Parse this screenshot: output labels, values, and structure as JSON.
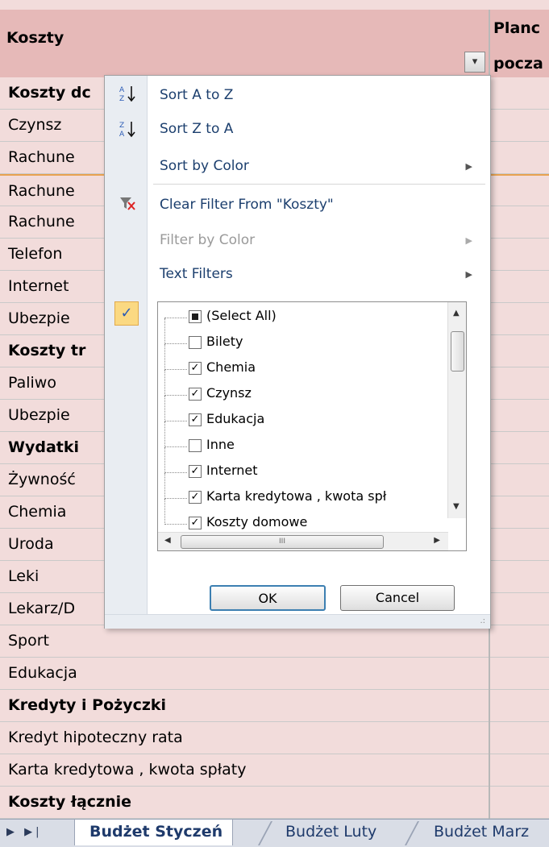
{
  "header": {
    "col_a": "Koszty",
    "col_b_line1": "Planc",
    "col_b_line2": "pocza"
  },
  "rows": [
    {
      "label": "Koszty dc",
      "bold": true
    },
    {
      "label": "Czynsz",
      "bold": false
    },
    {
      "label": "Rachune",
      "bold": false
    },
    {
      "label": "Rachune",
      "bold": false
    },
    {
      "label": "Rachune",
      "bold": false
    },
    {
      "label": "Telefon",
      "bold": false
    },
    {
      "label": "Internet",
      "bold": false
    },
    {
      "label": "Ubezpie",
      "bold": false
    },
    {
      "label": "Koszty tr",
      "bold": true
    },
    {
      "label": "Paliwo",
      "bold": false
    },
    {
      "label": "Ubezpie",
      "bold": false
    },
    {
      "label": "Wydatki",
      "bold": true
    },
    {
      "label": "Żywność",
      "bold": false
    },
    {
      "label": "Chemia",
      "bold": false
    },
    {
      "label": "Uroda",
      "bold": false
    },
    {
      "label": "Leki",
      "bold": false
    },
    {
      "label": "Lekarz/D",
      "bold": false
    },
    {
      "label": "Sport",
      "bold": false
    },
    {
      "label": "Edukacja",
      "bold": false
    },
    {
      "label": "Kredyty i Pożyczki",
      "bold": true
    },
    {
      "label": "Kredyt hipoteczny rata",
      "bold": false
    },
    {
      "label": "Karta kredytowa , kwota spłaty",
      "bold": false
    },
    {
      "label": "Koszty łącznie",
      "bold": true
    }
  ],
  "filter_menu": {
    "sort_az": "Sort A to Z",
    "sort_za": "Sort Z to A",
    "sort_by_color": "Sort by Color",
    "clear_filter": "Clear Filter From \"Koszty\"",
    "filter_by_color": "Filter by Color",
    "text_filters": "Text Filters",
    "list_items": [
      {
        "label": "(Select All)",
        "state": "partial"
      },
      {
        "label": "Bilety",
        "state": "unchecked"
      },
      {
        "label": "Chemia",
        "state": "checked"
      },
      {
        "label": "Czynsz",
        "state": "checked"
      },
      {
        "label": "Edukacja",
        "state": "checked"
      },
      {
        "label": "Inne",
        "state": "unchecked"
      },
      {
        "label": "Internet",
        "state": "checked"
      },
      {
        "label": "Karta kredytowa , kwota spł",
        "state": "checked"
      },
      {
        "label": "Koszty domowe",
        "state": "checked"
      }
    ],
    "ok_label": "OK",
    "cancel_label": "Cancel"
  },
  "sheet_tabs": [
    {
      "label": "Budżet Styczeń",
      "active": true
    },
    {
      "label": "Budżet Luty",
      "active": false
    },
    {
      "label": "Budżet Marz",
      "active": false
    }
  ],
  "colors": {
    "header_fill": "#e6b9b8",
    "cell_fill": "#f2dcdb",
    "menu_text": "#1c3f6e",
    "check_highlight": "#fbd982"
  }
}
